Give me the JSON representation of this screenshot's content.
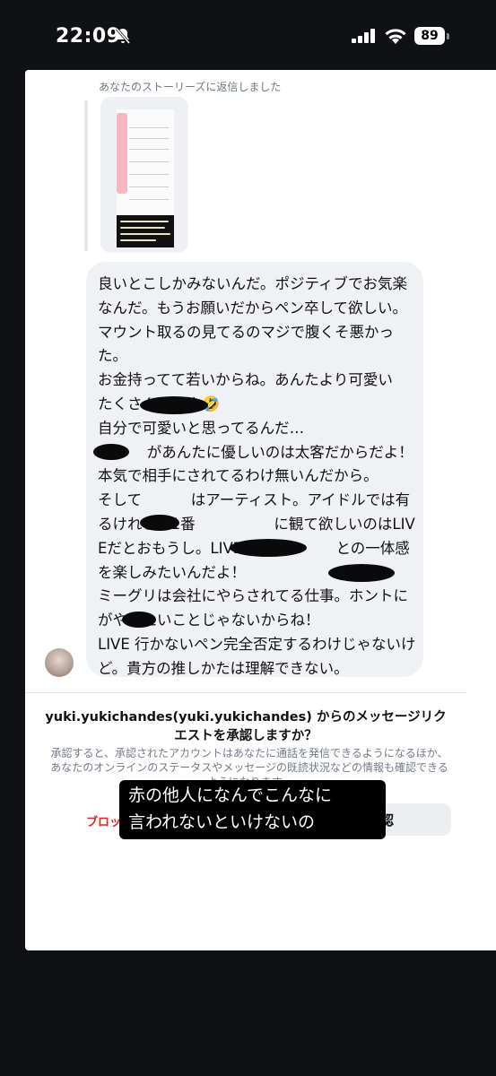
{
  "status_bar": {
    "time": "22:09",
    "battery": "89"
  },
  "story_reply": {
    "label": "あなたのストーリーズに返信しました"
  },
  "message": {
    "text": "良いとこしかみないんだ。ポジティブでお気楽なんだ。もうお願いだからペン卒して欲しい。\nマウント取るの見てるのマジで腹くそ悪かった。\nお金持ってて若いからね。あんたより可愛い　　　　　 たくさんいるよ🤣\n自分で可愛いと思ってるんだ…\n　　　 があんたに優しいのは太客だからだよ！\n本気で相手にされてるわけ無いんだから。\nそして　　　 はアーティスト。アイドルでは有るけれど。1番　　　　　 に観て欲しいのはLIVEだとおもうし。LIVEで　　　　　 との一体感を楽しみたいんだよ！\nミーグリは会社にやらされてる仕事。ホントに　　　 がやりたいことじゃないからね！\nLIVE 行かないペン完全否定するわけじゃないけど。貴方の推しかたは理解できない。"
  },
  "request": {
    "title": "yuki.yukichandes(yuki.yukichandes) からのメッセージリクエストを承認しますか？",
    "description": "承認すると、承認されたアカウントはあなたに通話を発信できるようになるほか、あなたのオンラインのステータスやメッセージの既読状況などの情報も確認できるようになります。",
    "block_label": "ブロッ",
    "accept_label": "認"
  },
  "overlay": {
    "subtitle": "赤の他人になんでこんなに\n言われないといけないの"
  },
  "colors": {
    "background": "#0f1115",
    "sheet": "#ffffff",
    "bubble": "#eff1f4",
    "block_red": "#e0241b"
  }
}
